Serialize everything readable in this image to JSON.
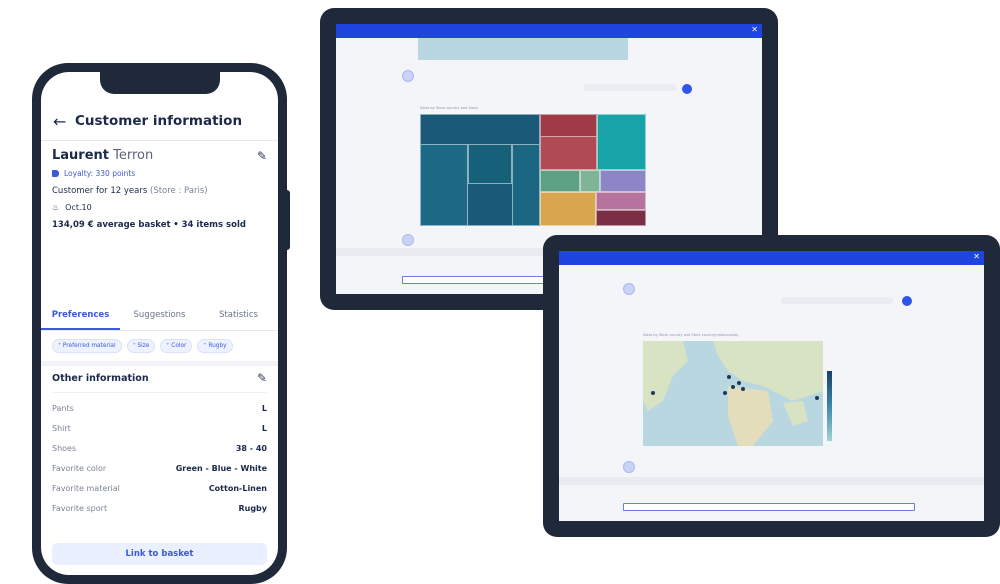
{
  "phone": {
    "title": "Customer information",
    "back_icon": "arrow-left-icon",
    "first_name": "Laurent",
    "last_name": "Terron",
    "loyalty": "Loyalty: 330 points",
    "customer_since_label": "Customer for 12 years",
    "store": "(Store : Paris)",
    "birthday": "Oct.10",
    "basket_amount": "134,09 € average basket",
    "items_sold": "• 34 items sold",
    "tabs": [
      "Preferences",
      "Suggestions",
      "Statistics"
    ],
    "chips": [
      "Preferred material",
      "Size",
      "Color",
      "Rugby"
    ],
    "other_title": "Other information",
    "rows": [
      {
        "k": "Pants",
        "v": "L"
      },
      {
        "k": "Shirt",
        "v": "L"
      },
      {
        "k": "Shoes",
        "v": "38 - 40"
      },
      {
        "k": "Favorite color",
        "v": "Green - Blue - White"
      },
      {
        "k": "Favorite material",
        "v": "Cotton-Linen"
      },
      {
        "k": "Favorite sport",
        "v": "Rugby"
      }
    ],
    "link_button": "Link to basket"
  },
  "tablet1": {
    "chart_title": "Sales by Store country and Store",
    "close_icon": "close-icon"
  },
  "tablet2": {
    "chart_title": "Sales by Store country and Store country(relationship)",
    "close_icon": "close-icon"
  },
  "colors": {
    "accent": "#3c5ad8",
    "bar_blue": "#1f45e0",
    "frame": "#20293a"
  }
}
